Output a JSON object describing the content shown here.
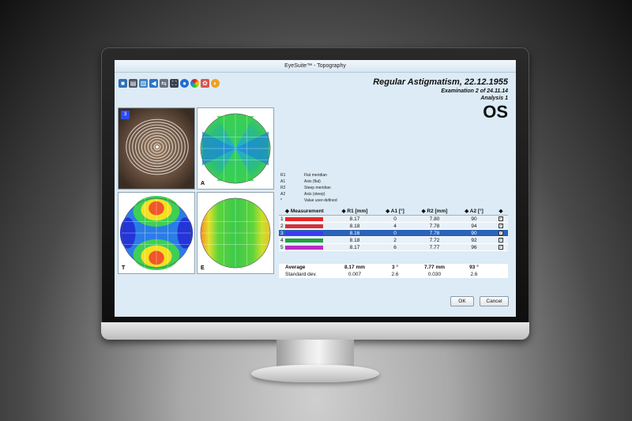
{
  "window": {
    "title": "EyeSuite™ - Topography"
  },
  "toolbar": {
    "icons": [
      "save-icon",
      "print-icon",
      "print-preview-icon",
      "back-icon",
      "nav-icon",
      "fit-icon",
      "eye-icon",
      "color-wheel-icon",
      "settings-icon",
      "help-icon"
    ]
  },
  "header": {
    "patient_line": "Regular Astigmatism,  22.12.1955",
    "examination": "Examination 2 of 24.11.14",
    "analysis": "Analysis 1",
    "eye": "OS"
  },
  "maps": {
    "photo_badge": "3",
    "labels": {
      "axial": "A",
      "tangential": "T",
      "elevation": "E"
    }
  },
  "legend": [
    {
      "key": "R1",
      "desc": "Flat meridian"
    },
    {
      "key": "A1",
      "desc": "Axis (flat)"
    },
    {
      "key": "R2",
      "desc": "Steep meridian"
    },
    {
      "key": "A2",
      "desc": "Axis (steep)"
    },
    {
      "key": "*",
      "desc": "Value user-defined"
    }
  ],
  "table": {
    "headers": {
      "measurement": "Measurement",
      "r1": "R1 [mm]",
      "a1": "A1 [°]",
      "r2": "R2 [mm]",
      "a2": "A2 [°]"
    },
    "rows": [
      {
        "num": "1",
        "color": "#e8262b",
        "r1": "8.17",
        "a1": "0",
        "r2": "7.80",
        "a2": "90",
        "checked": "✓"
      },
      {
        "num": "2",
        "color": "#d7303a",
        "r1": "8.18",
        "a1": "4",
        "r2": "7.78",
        "a2": "94",
        "checked": "✓"
      },
      {
        "num": "3",
        "color": "#3b3cf0",
        "r1": "8.16",
        "a1": "0",
        "r2": "7.78",
        "a2": "90",
        "checked": "✓"
      },
      {
        "num": "4",
        "color": "#1ea43a",
        "r1": "8.18",
        "a1": "2",
        "r2": "7.72",
        "a2": "92",
        "checked": "✓"
      },
      {
        "num": "5",
        "color": "#b52cc2",
        "r1": "8.17",
        "a1": "6",
        "r2": "7.77",
        "a2": "96",
        "checked": "✓"
      }
    ],
    "selected_row": 2
  },
  "summary": {
    "average": {
      "label": "Average",
      "r1": "8.17 mm",
      "a1": "3 °",
      "r2": "7.77 mm",
      "a2": "93 °"
    },
    "stddev": {
      "label": "Standard dev.",
      "r1": "0.007",
      "a1": "2.6",
      "r2": "0.030",
      "a2": "2.6"
    }
  },
  "buttons": {
    "ok": "OK",
    "cancel": "Cancel"
  },
  "colors": {
    "accent": "#2a63b8",
    "background": "#dcebf5"
  }
}
